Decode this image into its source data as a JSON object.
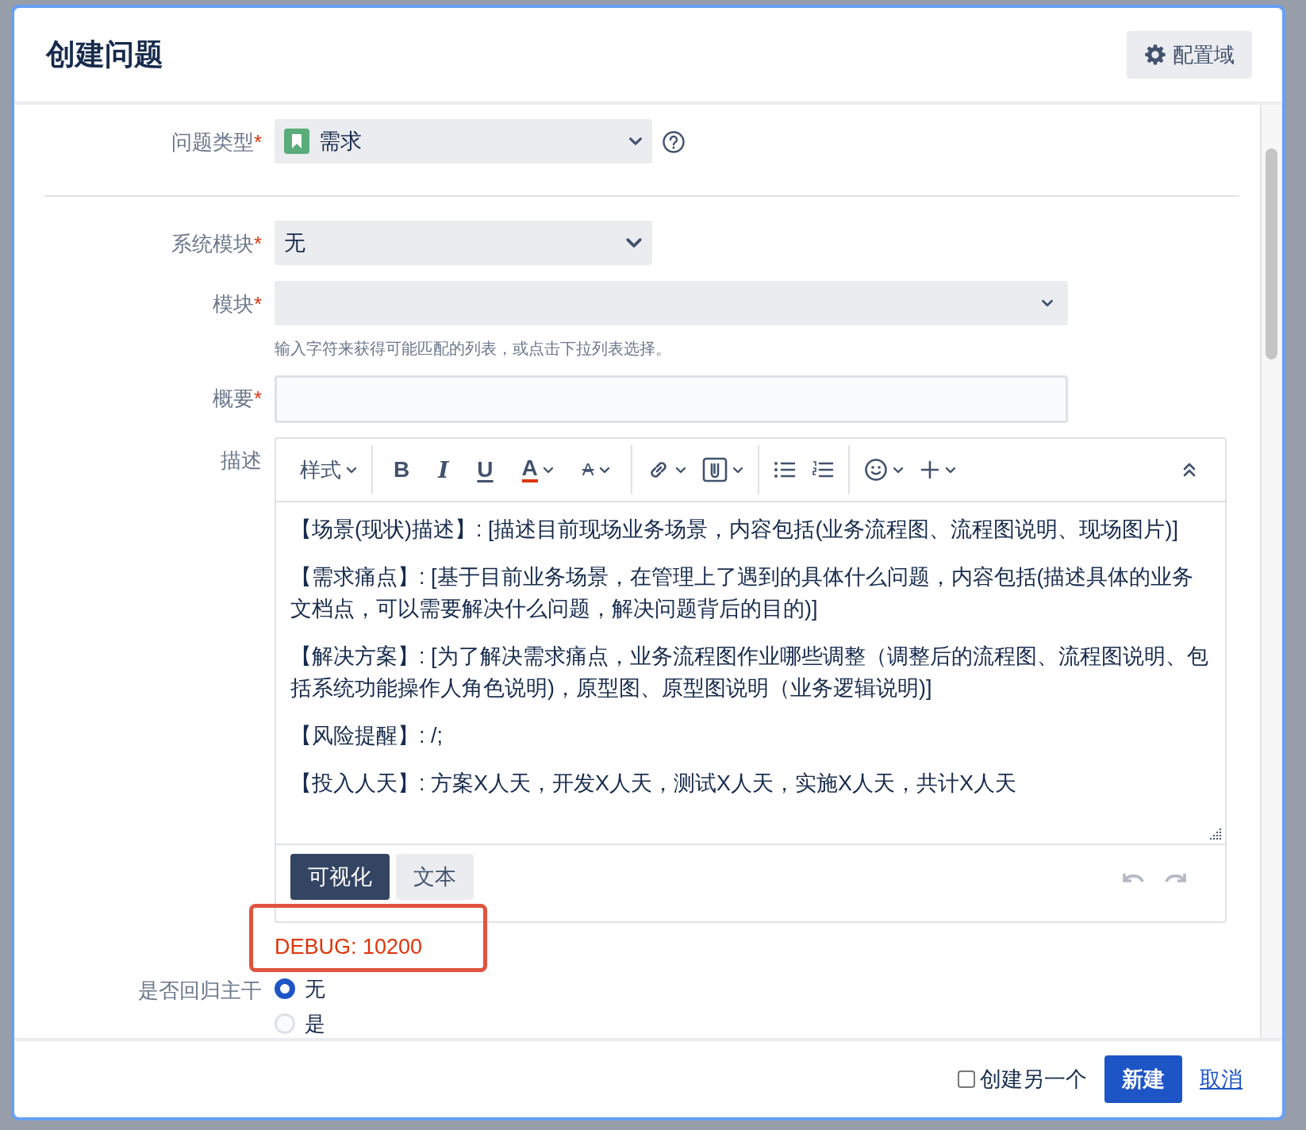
{
  "dialog": {
    "title": "创建问题",
    "config_button": "配置域"
  },
  "fields": [
    {
      "kind": "type-select",
      "label": "问题类型",
      "required_mark": "*",
      "value": "需求"
    },
    {
      "kind": "select",
      "label": "系统模块",
      "required_mark": "*",
      "value": "无"
    },
    {
      "kind": "wide-select",
      "label": "模块",
      "required_mark": "*",
      "hint": "输入字符来获得可能匹配的列表，或点击下拉列表选择。"
    },
    {
      "kind": "text",
      "label": "概要",
      "required_mark": "*"
    },
    {
      "kind": "editor",
      "label": "描述",
      "style_menu": "样式",
      "format_buttons": [
        {
          "kind": "bold",
          "label": "B"
        },
        {
          "kind": "italic",
          "label": "I"
        },
        {
          "kind": "underline",
          "label": "U"
        },
        {
          "kind": "color",
          "label": "A"
        },
        {
          "kind": "effects",
          "label": "A"
        }
      ],
      "paragraphs": [
        "【场景(现状)描述】: [描述目前现场业务场景，内容包括(业务流程图、流程图说明、现场图片)]",
        "【需求痛点】: [基于目前业务场景，在管理上了遇到的具体什么问题，内容包括(描述具体的业务文档点，可以需要解决什么问题，解决问题背后的目的)]",
        "【解决方案】: [为了解决需求痛点，业务流程图作业哪些调整（调整后的流程图、流程图说明、包括系统功能操作人角色说明)，原型图、原型图说明（业务逻辑说明)]",
        "【风险提醒】: /;",
        "【投入人天】: 方案X人天，开发X人天，测试X人天，实施X人天，共计X人天"
      ],
      "modes": [
        {
          "label": "可视化",
          "selected": true
        },
        {
          "label": "文本",
          "selected": false
        }
      ]
    },
    {
      "kind": "debug",
      "text": "DEBUG: 10200",
      "highlighted": true
    },
    {
      "kind": "radio",
      "label": "是否回归主干",
      "options": [
        {
          "label": "无",
          "selected": true
        },
        {
          "label": "是",
          "selected": false
        }
      ]
    }
  ],
  "footer": {
    "create_another": {
      "label": "创建另一个",
      "checked": false
    },
    "submit": "新建",
    "cancel": "取消"
  }
}
